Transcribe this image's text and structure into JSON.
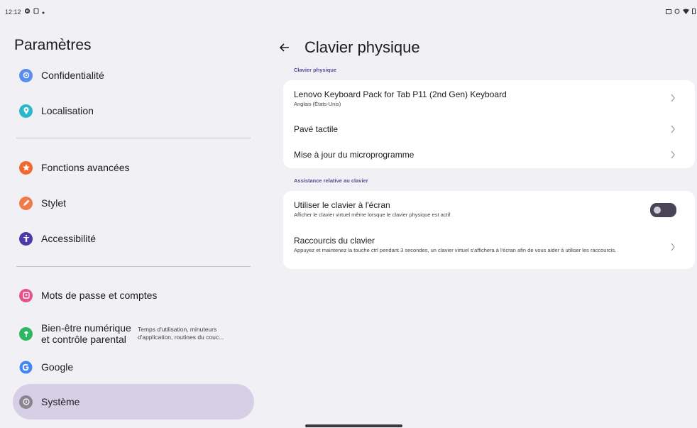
{
  "status_bar": {
    "time": "12:12"
  },
  "left_panel": {
    "title": "Paramètres",
    "items": [
      {
        "label": "Confidentialité",
        "icon": "privacy-icon",
        "color": "#5b8def"
      },
      {
        "label": "Localisation",
        "icon": "location-icon",
        "color": "#2ab7c9"
      },
      {
        "label": "Fonctions avancées",
        "icon": "star-icon",
        "color": "#f0682e"
      },
      {
        "label": "Stylet",
        "icon": "pen-icon",
        "color": "#ef7a4a"
      },
      {
        "label": "Accessibilité",
        "icon": "accessibility-icon",
        "color": "#4b3aa8"
      },
      {
        "label": "Mots de passe et comptes",
        "icon": "key-icon",
        "color": "#e8508c"
      },
      {
        "label": "Bien-être numérique et contrôle parental",
        "sub": "Temps d'utilisation, minuteurs d'application, routines du couc...",
        "icon": "wellbeing-icon",
        "color": "#2bb65f"
      },
      {
        "label": "Google",
        "icon": "google-icon",
        "color": "#4285f4"
      },
      {
        "label": "Système",
        "icon": "info-icon",
        "color": "#8a8690"
      }
    ]
  },
  "right_panel": {
    "title": "Clavier physique",
    "section1_header": "Clavier physique",
    "keyboard": {
      "title": "Lenovo Keyboard Pack for Tab P11 (2nd Gen) Keyboard",
      "sub": "Anglais (États-Unis)"
    },
    "touchpad": {
      "title": "Pavé tactile"
    },
    "firmware": {
      "title": "Mise à jour du microprogramme"
    },
    "section2_header": "Assistance relative au clavier",
    "onscreen": {
      "title": "Utiliser le clavier à l'écran",
      "sub": "Afficher le clavier virtuel même lorsque le clavier physique est actif",
      "enabled": false
    },
    "shortcuts": {
      "title": "Raccourcis du clavier",
      "sub": "Appuyez et maintenez la touche ctrl pendant 3 secondes, un clavier virtuel s'affichera à l'écran afin de vous aider à utiliser les raccourcis."
    }
  }
}
